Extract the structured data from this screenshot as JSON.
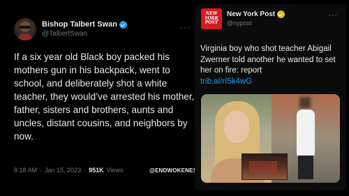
{
  "left_tweet": {
    "display_name": "Bishop Talbert Swan",
    "handle": "@TalbertSwan",
    "more": "···",
    "text": "If a six year old Black boy packed his mothers gun in his backpack, went to school, and deliberately shot a white teacher, they would’ve arrested his mother, father, sisters and brothers, aunts and uncles, distant cousins, and neighbors by now.",
    "time": "8:18 AM",
    "sep": "·",
    "date": "Jan 15, 2023",
    "views_count": "951K",
    "views_label": "Views"
  },
  "watermark": "@ENDWOKENESS",
  "right_tweet": {
    "logo_line1": "NEW",
    "logo_line2": "YORK",
    "logo_line3": "POST",
    "display_name": "New York Post",
    "handle": "@nypost",
    "more": "···",
    "text": "Virginia boy who shot teacher Abigail Zwerner told another he wanted to set her on fire: report",
    "link": "trib.al/rI5k4wG"
  },
  "colors": {
    "background": "#000000",
    "text": "#e7e9ea",
    "muted": "#71767b",
    "link": "#1d9bf0",
    "verified_blue": "#1d9bf0",
    "verified_gold": "#e2b719",
    "nyp_red": "#d71920"
  }
}
